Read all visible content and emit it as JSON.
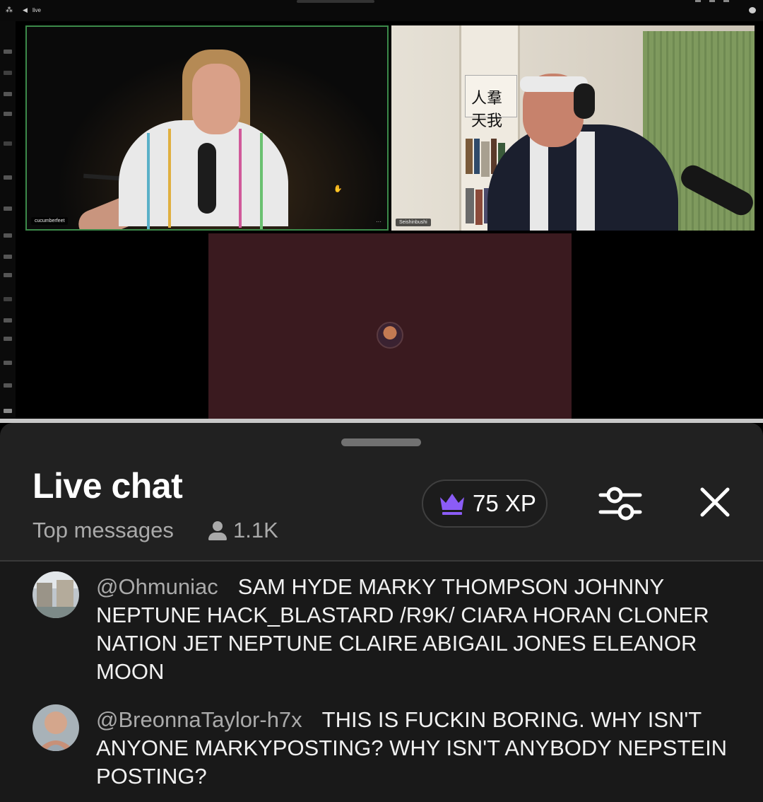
{
  "video": {
    "tab_title": "live",
    "tiles": [
      {
        "name": "cucumberfeet"
      },
      {
        "name": "Seishinbushi"
      },
      {
        "name": ""
      }
    ],
    "calligraphy": "人羣天我",
    "tile_menu": "···"
  },
  "chat": {
    "title": "Live chat",
    "mode": "Top messages",
    "viewer_count": "1.1K",
    "xp": "75 XP",
    "icons": {
      "viewers": "person-icon",
      "xp": "crown-icon",
      "filter": "sliders-icon",
      "close": "close-icon"
    },
    "colors": {
      "panel_bg": "#212121",
      "list_bg": "#191919",
      "crown": "#8b5cf6",
      "muted_text": "#aaaaaa"
    },
    "messages": [
      {
        "author": "@Ohmuniac",
        "text": "SAM HYDE MARKY THOMPSON JOHNNY NEPTUNE HACK_BLASTARD /R9K/ CIARA HORAN CLONER NATION JET NEPTUNE CLAIRE ABIGAIL JONES ELEANOR MOON"
      },
      {
        "author": "@BreonnaTaylor-h7x",
        "text": "THIS IS FUCKIN BORING. WHY ISN'T ANYONE MARKYPOSTING? WHY ISN'T ANYBODY NEPSTEIN POSTING?"
      }
    ]
  }
}
